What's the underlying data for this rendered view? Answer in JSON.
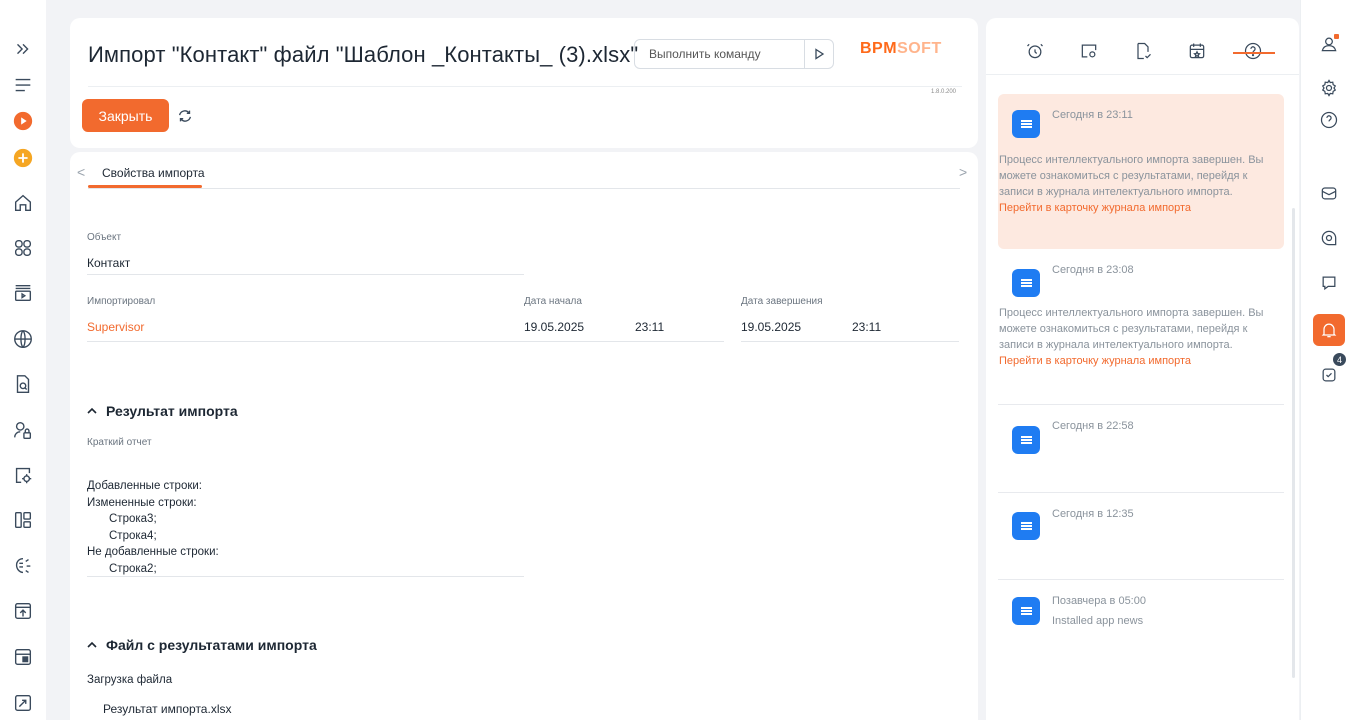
{
  "header": {
    "title": "Импорт \"Контакт\" файл \"Шаблон _Контакты_ (3).xlsx\"",
    "command_placeholder": "Выполнить команду",
    "logo_part1": "BPM",
    "logo_part2": "SOFT",
    "version": "1.8.0.200",
    "close_label": "Закрыть"
  },
  "tabs": {
    "properties": "Свойства импорта"
  },
  "fields": {
    "object_label": "Объект",
    "object_value": "Контакт",
    "imported_by_label": "Импортировал",
    "imported_by_value": "Supervisor",
    "start_date_label": "Дата начала",
    "start_date": "19.05.2025",
    "start_time": "23:11",
    "end_date_label": "Дата завершения",
    "end_date": "19.05.2025",
    "end_time": "23:11"
  },
  "result_section": {
    "title": "Результат импорта",
    "summary_label": "Краткий отчет",
    "lines": [
      "Добавленные строки:",
      "Измененные строки:",
      "Строка3;",
      "Строка4;",
      "Не добавленные строки:",
      "Строка2;"
    ]
  },
  "file_section": {
    "title": "Файл с результатами импорта",
    "upload_label": "Загрузка файла",
    "file_name": "Результат импорта.xlsx"
  },
  "notifications": [
    {
      "time": "Сегодня в 23:11",
      "body": "Процесс интеллектуального импорта завершен. Вы можете ознакомиться с результатами, перейдя к записи в журнала интелектуального импорта.",
      "link": "Перейти в карточку журнала импорта"
    },
    {
      "time": "Сегодня в 23:08",
      "body": "Процесс интеллектуального импорта завершен. Вы можете ознакомиться с результатами, перейдя к записи в журнала интелектуального импорта.",
      "link": "Перейти в карточку журнала импорта"
    },
    {
      "time": "Сегодня в 22:58"
    },
    {
      "time": "Сегодня в 12:35"
    },
    {
      "time": "Позавчера в 05:00",
      "body": "Installed app news"
    }
  ],
  "right_bar": {
    "tasks_badge": "4"
  },
  "colors": {
    "accent": "#f26a2e",
    "notif_icon": "#1f7cf2",
    "unread_bg": "#fde9e0"
  }
}
